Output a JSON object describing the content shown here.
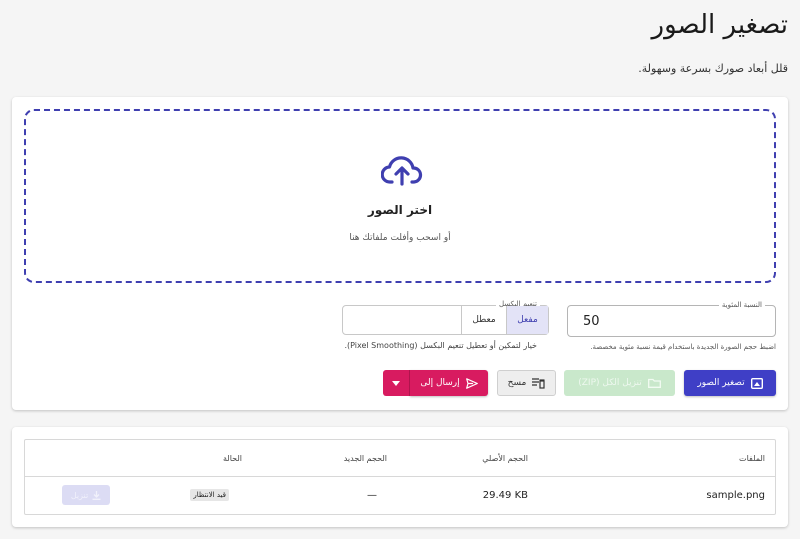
{
  "page": {
    "title": "تصغير الصور",
    "subtitle": "قلل أبعاد صورك بسرعة وسهولة."
  },
  "dropzone": {
    "title": "اختر الصور",
    "hint": "أو اسحب وأفلت ملفاتك هنا",
    "icon": "cloud-upload-icon",
    "border_color": "#3f3fb0"
  },
  "percentage": {
    "label": "النسبة المئوية",
    "value": "50",
    "help": "اضبط حجم الصورة الجديدة باستخدام قيمة نسبة مئوية مخصصة."
  },
  "smoothing": {
    "label": "تنعيم البكسل",
    "on_label": "مفعل",
    "off_label": "معطل",
    "selected": "مفعل",
    "help": "خيار لتمكين أو تعطيل تنعيم البكسل (Pixel Smoothing)."
  },
  "actions": {
    "resize_label": "تصغير الصور",
    "zip_label": "تنزيل الكل (ZIP)",
    "clear_label": "مسح",
    "send_label": "إرسال إلى"
  },
  "colors": {
    "primary": "#3f3fc6",
    "secondary": "#d81b60",
    "success_disabled": "#c9e8cb"
  },
  "table": {
    "headers": {
      "files": "الملفات",
      "original_size": "الحجم الأصلي",
      "new_size": "الحجم الجديد",
      "status": "الحالة"
    },
    "rows": [
      {
        "file": "sample.png",
        "original_size": "29.49 KB",
        "new_size": "—",
        "status": "قيد الانتظار",
        "download_label": "تنزيل"
      }
    ]
  }
}
